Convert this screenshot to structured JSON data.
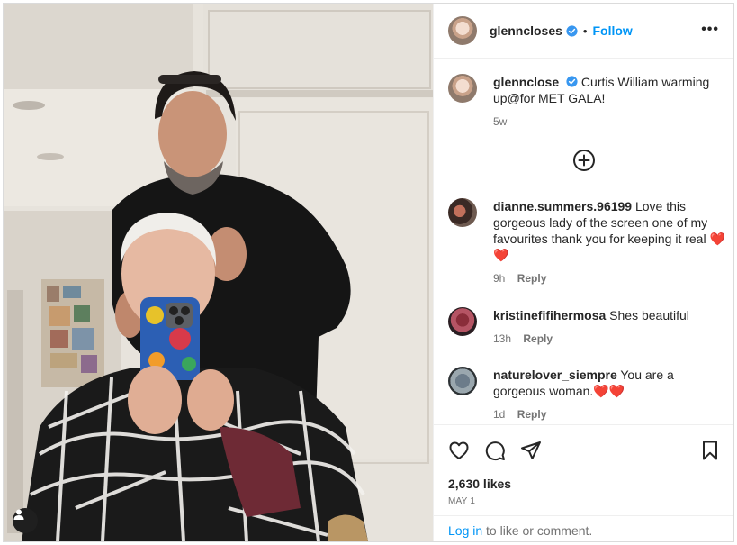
{
  "post": {
    "author": "glenncloses",
    "follow_label": "Follow",
    "separator": "•",
    "more_label": "•••",
    "caption_author": "glennclose",
    "caption_text": "Curtis William warming up@for MET GALA!",
    "caption_time": "5w"
  },
  "comments": [
    {
      "user": "dianne.summers.96199",
      "text": "Love this gorgeous lady of the screen one of my favourites thank you for keeping it real ❤️❤️",
      "time": "9h",
      "reply": "Reply"
    },
    {
      "user": "kristinefifihermosa",
      "text": "Shes beautiful",
      "time": "13h",
      "reply": "Reply"
    },
    {
      "user": "naturelover_siempre",
      "text": "You are a gorgeous woman.❤️❤️",
      "time": "1d",
      "reply": "Reply"
    }
  ],
  "footer": {
    "likes": "2,630 likes",
    "date": "MAY 1",
    "login_link": "Log in",
    "login_rest": " to like or comment."
  },
  "icons": {
    "verified": "verified-badge-icon",
    "load_more": "plus-circle-icon",
    "like": "heart-icon",
    "comment": "comment-bubble-icon",
    "share": "paper-plane-icon",
    "save": "bookmark-icon",
    "user_tag": "user-tag-icon"
  },
  "colors": {
    "link": "#0095f6",
    "verified": "#3897f0",
    "muted": "#737373"
  }
}
